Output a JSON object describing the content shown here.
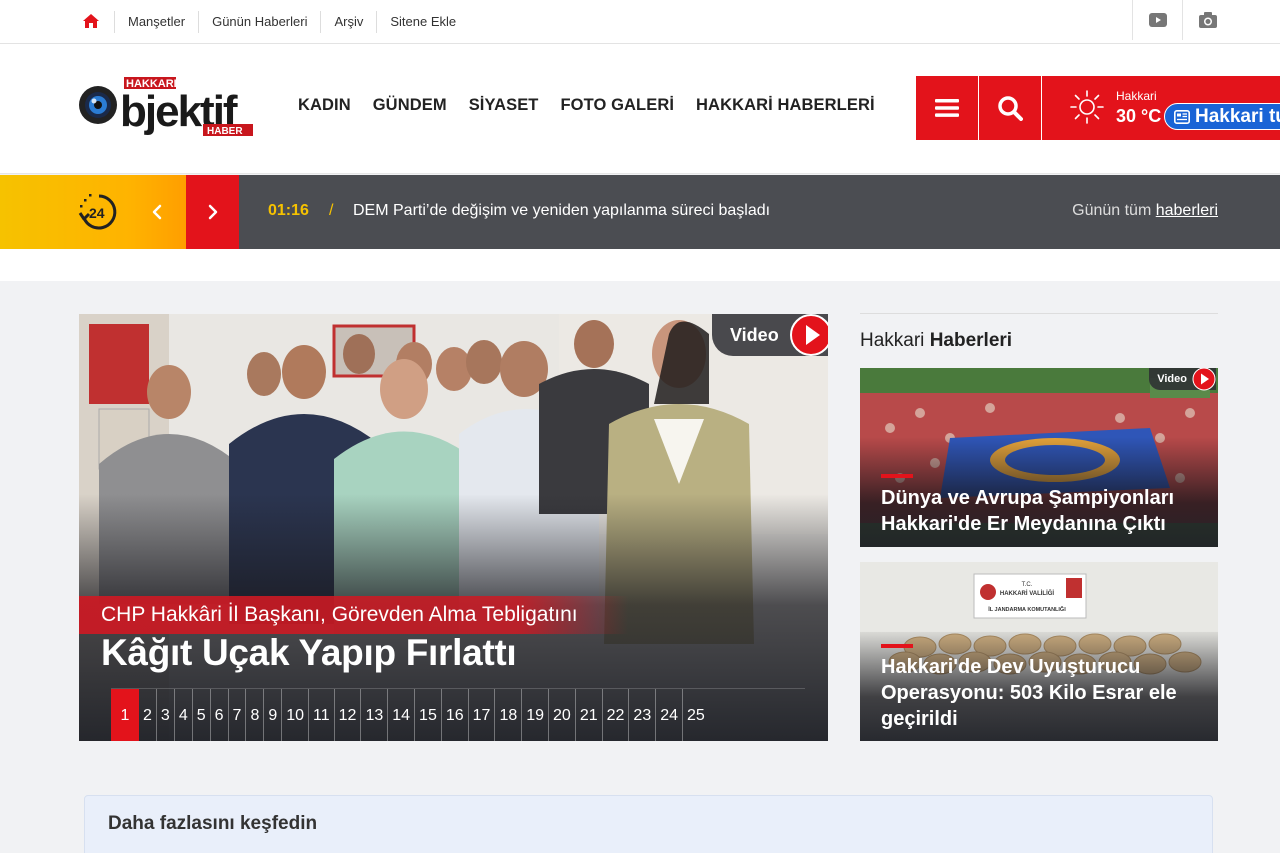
{
  "topbar": {
    "links": [
      "Manşetler",
      "Günün Haberleri",
      "Arşiv",
      "Sitene Ekle"
    ]
  },
  "header": {
    "logo_text": "HAKKARI Objektif HABER",
    "nav": [
      "KADIN",
      "GÜNDEM",
      "SİYASET",
      "FOTO GALERİ",
      "HAKKARİ HABERLERİ"
    ],
    "weather": {
      "city": "Hakkari",
      "temp": "30 °C",
      "chip_label": "Hakkari tu"
    }
  },
  "breaking": {
    "time": "01:16",
    "separator": "/",
    "headline": "DEM Parti’de değişim ve yeniden yapılanma süreci başladı",
    "all_prefix": "Günün tüm",
    "all_link": "haberleri",
    "clock_label": "24"
  },
  "slider": {
    "badge": "Video",
    "subtitle": "CHP Hakkâri İl Başkanı, Görevden Alma Tebligatını",
    "title": "Kâğıt Uçak Yapıp Fırlattı",
    "pages": [
      "1",
      "2",
      "3",
      "4",
      "5",
      "6",
      "7",
      "8",
      "9",
      "10",
      "11",
      "12",
      "13",
      "14",
      "15",
      "16",
      "17",
      "18",
      "19",
      "20",
      "21",
      "22",
      "23",
      "24",
      "25"
    ],
    "active_page": "1"
  },
  "side": {
    "title_plain": "Hakkari",
    "title_bold": "Haberleri",
    "cards": [
      {
        "title": "Dünya ve Avrupa Şampiyonları Hakkari'de Er Meydanına Çıktı",
        "badge": "Video"
      },
      {
        "title": "Hakkari'de Dev Uyuşturucu Operasyonu: 503 Kilo Esrar ele geçirildi",
        "sign_line1": "T.C.",
        "sign_line2": "HAKKARİ VALİLİĞİ",
        "sign_line3": "İL JANDARMA KOMUTANLIĞI"
      }
    ]
  },
  "explore": {
    "label": "Daha fazlasını keşfedin"
  },
  "colors": {
    "accent": "#e3131b",
    "yellow": "#f6c200",
    "dark": "#4b4d52",
    "chip": "#1a64d6"
  },
  "icons": [
    "home-icon",
    "youtube-icon",
    "camera-icon",
    "menu-icon",
    "search-icon",
    "sun-icon",
    "news-icon",
    "clock-24-icon",
    "chevron-left-icon",
    "chevron-right-icon",
    "play-icon"
  ]
}
